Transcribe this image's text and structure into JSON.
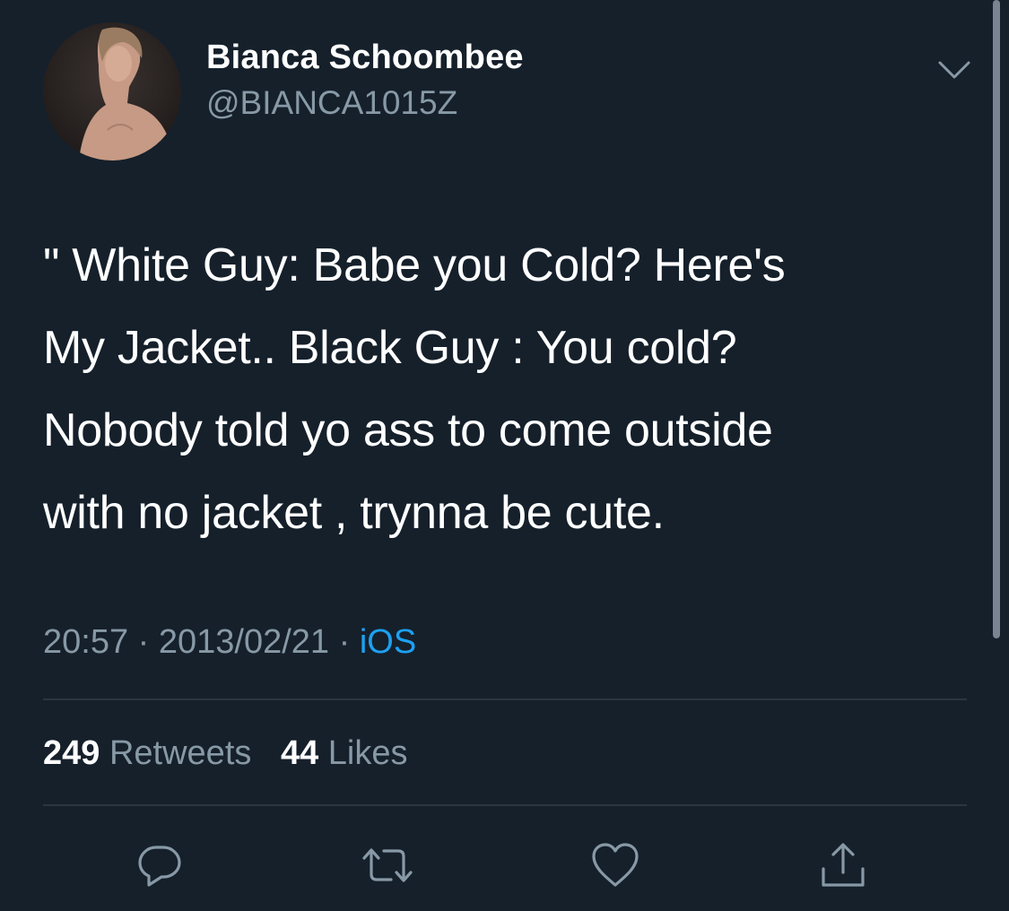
{
  "tweet": {
    "author": {
      "display_name": "Bianca Schoombee",
      "handle": "@BIANCA1015Z"
    },
    "text_lines": [
      "\" White Guy: Babe you Cold? Here's",
      "My Jacket.. Black Guy : You cold?",
      "Nobody told yo ass to come outside",
      "with no jacket , trynna be cute."
    ],
    "meta": {
      "time": "20:57",
      "separator": "·",
      "date": "2013/02/21",
      "source": "iOS"
    },
    "stats": {
      "retweets_count": "249",
      "retweets_label": "Retweets",
      "likes_count": "44",
      "likes_label": "Likes"
    },
    "actions": [
      "reply-icon",
      "retweet-icon",
      "like-icon",
      "share-icon"
    ]
  },
  "colors": {
    "background": "#15202b",
    "text_primary": "#ffffff",
    "text_secondary": "#8899a6",
    "accent": "#1da1f2",
    "divider": "#2c3640"
  }
}
